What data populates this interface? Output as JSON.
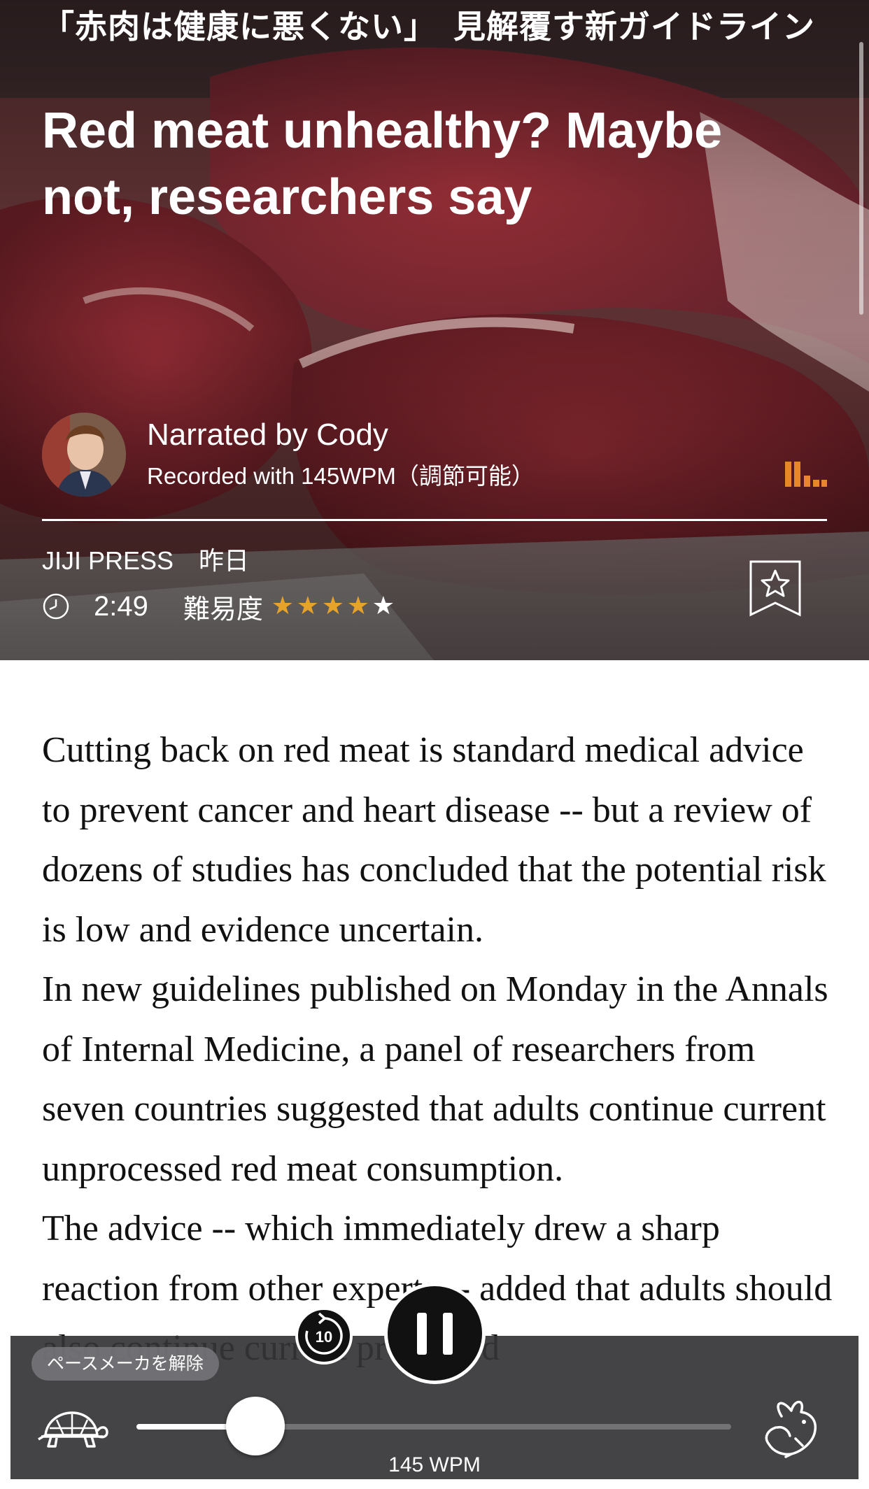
{
  "header": {
    "title_jp": "「赤肉は健康に悪くない」　見解覆す新ガイドライン",
    "title_en": "Red meat unhealthy? Maybe not, researchers say"
  },
  "narrator": {
    "narrated_by": "Narrated by Cody",
    "recorded_with": "Recorded with 145WPM（調節可能）",
    "icon": "bars-icon"
  },
  "meta": {
    "source": "JIJI PRESS　昨日",
    "duration": "2:49",
    "difficulty_label": "難易度",
    "difficulty_rating": 4,
    "difficulty_max": 5,
    "bookmark_icon": "star-bookmark-icon"
  },
  "article": {
    "paragraphs": [
      "Cutting back on red meat is standard medical advice to prevent cancer and heart disease -- but a review of dozens of studies has concluded that the potential risk is low and evidence uncertain.",
      "In new guidelines published on Monday in the Annals of Internal Medicine, a panel of researchers from seven countries suggested that adults continue current unprocessed red meat consumption.",
      "The advice -- which immediately drew a sharp reaction from other experts -- added that adults should also continue current processed"
    ]
  },
  "player": {
    "pacemaker_label": "ペースメーカを解除",
    "replay_label": "10",
    "wpm_label": "145 WPM",
    "speed_fraction": 0.2,
    "slow_icon": "turtle-icon",
    "fast_icon": "rabbit-icon",
    "state": "playing"
  },
  "colors": {
    "star_filled": "#e5a32a",
    "bars_icon": "#e8872a",
    "player_bg": "#343436"
  }
}
